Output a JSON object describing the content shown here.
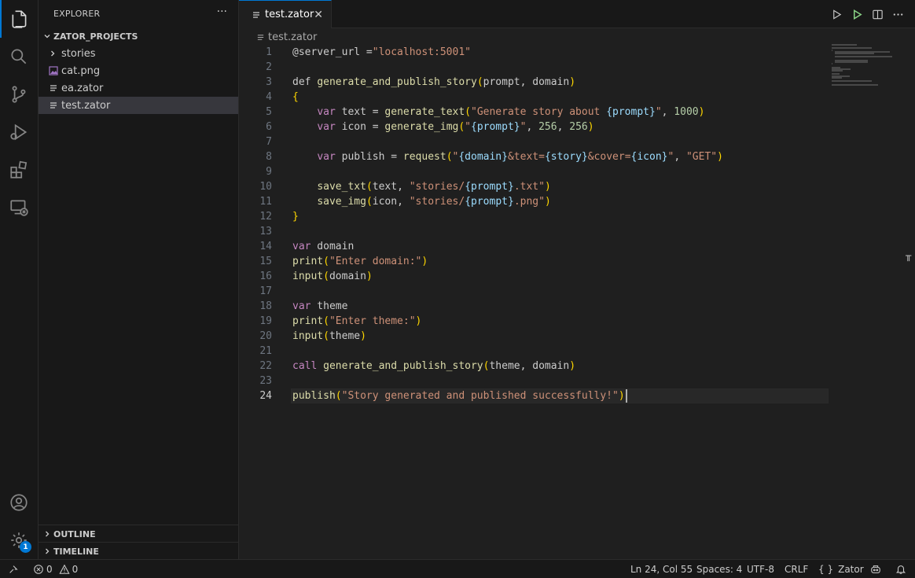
{
  "sidebar": {
    "title": "EXPLORER",
    "more": "···",
    "project": "ZATOR_PROJECTS",
    "items": [
      {
        "label": "stories",
        "kind": "folder"
      },
      {
        "label": "cat.png",
        "kind": "image"
      },
      {
        "label": "ea.zator",
        "kind": "file"
      },
      {
        "label": "test.zator",
        "kind": "file",
        "selected": true
      }
    ],
    "outline": "OUTLINE",
    "timeline": "TIMELINE"
  },
  "activity": {
    "icons": [
      "files-icon",
      "search-icon",
      "source-control-icon",
      "run-debug-icon",
      "extensions-icon",
      "remote-explorer-icon",
      "account-icon",
      "settings-gear-icon"
    ],
    "settings_badge": "1"
  },
  "editor": {
    "tab_label": "test.zator",
    "tab_close": "✕",
    "breadcrumb": "test.zator",
    "lines": [
      "@server_url =\"localhost:5001\"",
      "",
      "def generate_and_publish_story(prompt, domain)",
      "{",
      "    var text = generate_text(\"Generate story about {prompt}\", 1000)",
      "    var icon = generate_img(\"{prompt}\", 256, 256)",
      "",
      "    var publish = request(\"{domain}&text={story}&cover={icon}\", \"GET\")",
      "",
      "    save_txt(text, \"stories/{prompt}.txt\")",
      "    save_img(icon, \"stories/{prompt}.png\")",
      "}",
      "",
      "var domain",
      "print(\"Enter domain:\")",
      "input(domain)",
      "",
      "var theme",
      "print(\"Enter theme:\")",
      "input(theme)",
      "",
      "call generate_and_publish_story(theme, domain)",
      "",
      "publish(\"Story generated and published successfully!\")"
    ],
    "current_line": 24
  },
  "statusbar": {
    "errors": "0",
    "warnings": "0",
    "position": "Ln 24, Col 55",
    "spaces": "Spaces: 4",
    "encoding": "UTF-8",
    "eol": "CRLF",
    "language": "Zator",
    "language_icon": "{ }"
  },
  "colors": {
    "accent": "#0078d4",
    "keyword": "#c586c0",
    "function": "#dcdcaa",
    "string": "#ce9178",
    "number": "#b5cea8",
    "interp": "#9cdcfe"
  }
}
